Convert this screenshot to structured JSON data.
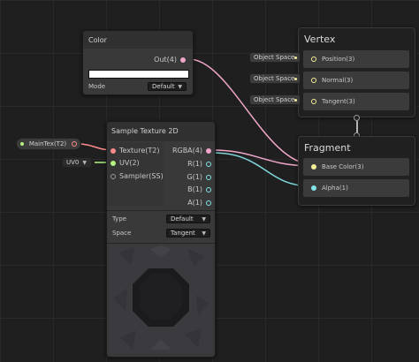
{
  "color_node": {
    "title": "Color",
    "out_label": "Out(4)",
    "mode_label": "Mode",
    "mode_value": "Default"
  },
  "sample_node": {
    "title": "Sample Texture 2D",
    "inputs": [
      "Texture(T2)",
      "UV(2)",
      "Sampler(SS)"
    ],
    "outputs": [
      "RGBA(4)",
      "R(1)",
      "G(1)",
      "B(1)",
      "A(1)"
    ],
    "type_label": "Type",
    "type_value": "Default",
    "space_label": "Space",
    "space_value": "Tangent"
  },
  "maintex_property": {
    "label": "MainTex(T2)"
  },
  "uv_dropdown": {
    "value": "UV0"
  },
  "vertex_context": {
    "title": "Vertex",
    "slots": [
      {
        "input": "Object Space",
        "label": "Position(3)"
      },
      {
        "input": "Object Space",
        "label": "Normal(3)"
      },
      {
        "input": "Object Space",
        "label": "Tangent(3)"
      }
    ]
  },
  "fragment_context": {
    "title": "Fragment",
    "slots": [
      {
        "label": "Base Color(3)"
      },
      {
        "label": "Alpha(1)"
      }
    ]
  },
  "colors": {
    "background": "#1f1f1f",
    "node": "#393939",
    "vector_port": "#f5ef9a",
    "float_port": "#84e4e7",
    "texture_port": "#ff8b8b",
    "uv_port": "#b3f47f",
    "wire_color": "#ff8bbf",
    "wire_rgba": "#f7b6d4",
    "wire_alpha": "#84e4e7"
  }
}
